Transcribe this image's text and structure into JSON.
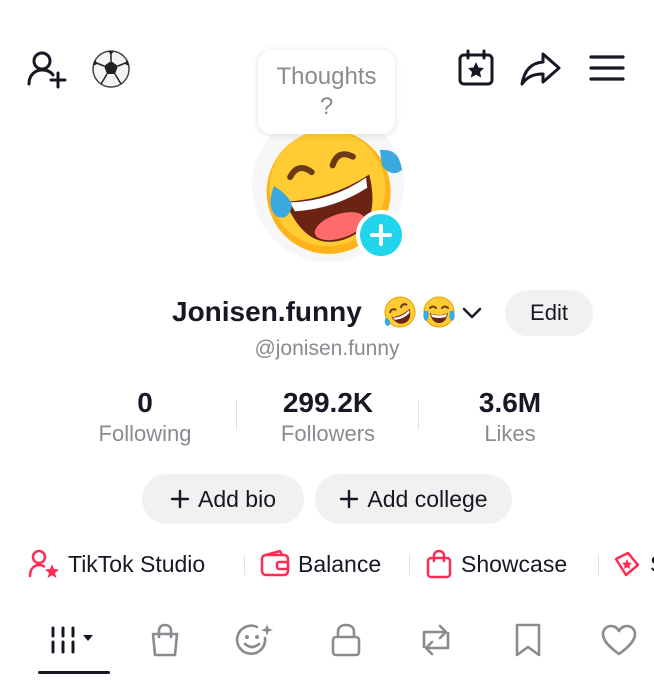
{
  "header": {
    "add_friend_icon": "person-plus-icon",
    "soccer_icon": "soccer-ball-icon",
    "calendar_icon": "calendar-star-icon",
    "share_icon": "share-arrow-icon",
    "menu_icon": "hamburger-menu-icon"
  },
  "thoughts": {
    "line1": "Thoughts",
    "line2": "?"
  },
  "profile": {
    "username": "Jonisen.funny",
    "handle": "@jonisen.funny",
    "edit_label": "Edit"
  },
  "stats": [
    {
      "value": "0",
      "label": "Following"
    },
    {
      "value": "299.2K",
      "label": "Followers"
    },
    {
      "value": "3.6M",
      "label": "Likes"
    }
  ],
  "actions": {
    "add_bio": "Add bio",
    "add_college": "Add college"
  },
  "links": [
    {
      "label": "TikTok Studio",
      "icon": "person-star-icon"
    },
    {
      "label": "Balance",
      "icon": "wallet-icon"
    },
    {
      "label": "Showcase",
      "icon": "shopping-bag-icon"
    },
    {
      "label": "S",
      "icon": "star-tag-icon"
    }
  ],
  "tabs": [
    {
      "icon": "grid-videos-icon",
      "active": true
    },
    {
      "icon": "shop-bag-icon"
    },
    {
      "icon": "smiley-sparkle-icon"
    },
    {
      "icon": "lock-icon"
    },
    {
      "icon": "repost-icon"
    },
    {
      "icon": "bookmark-icon"
    },
    {
      "icon": "heart-icon"
    }
  ],
  "colors": {
    "text": "#161823",
    "secondary": "#8a8b91",
    "pill_bg": "#f1f1f2",
    "accent_pink": "#fe2c55",
    "add_blue": "#20d5ec"
  }
}
